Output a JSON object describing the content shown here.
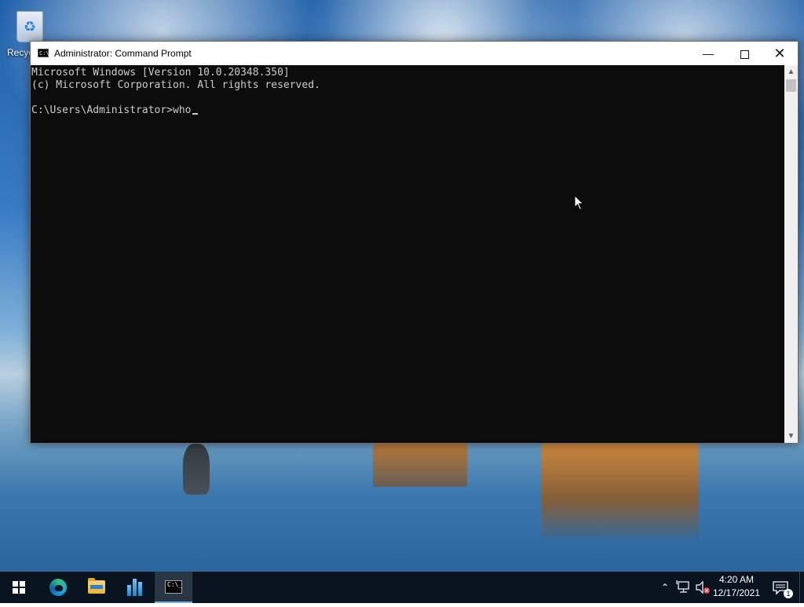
{
  "desktop": {
    "recycle_bin_label": "Recyc"
  },
  "window": {
    "title": "Administrator: Command Prompt",
    "icon_text": "C:\\",
    "minimize_glyph": "—",
    "close_glyph": "✕"
  },
  "console": {
    "lines": [
      "Microsoft Windows [Version 10.0.20348.350]",
      "(c) Microsoft Corporation. All rights reserved.",
      "C:\\Users\\Administrator>who"
    ]
  },
  "scrollbar": {
    "up_glyph": "▲",
    "down_glyph": "▼"
  },
  "taskbar": {
    "items": [
      {
        "name": "start-button",
        "icon": "windows-logo-icon"
      },
      {
        "name": "edge-button",
        "icon": "edge-icon"
      },
      {
        "name": "file-explorer-button",
        "icon": "folder-icon"
      },
      {
        "name": "server-manager-button",
        "icon": "server-manager-icon"
      },
      {
        "name": "command-prompt-button",
        "icon": "cmd-icon",
        "active": true
      }
    ],
    "cmd_icon_text": "C:\\_"
  },
  "tray": {
    "chevron_glyph": "⌃",
    "time": "4:20 AM",
    "date": "12/17/2021",
    "notification_count": "1"
  },
  "colors": {
    "console_bg": "#0c0c0c",
    "console_text": "#cccccc",
    "taskbar_bg": "#0a1420",
    "accent": "#7ab0e8"
  }
}
